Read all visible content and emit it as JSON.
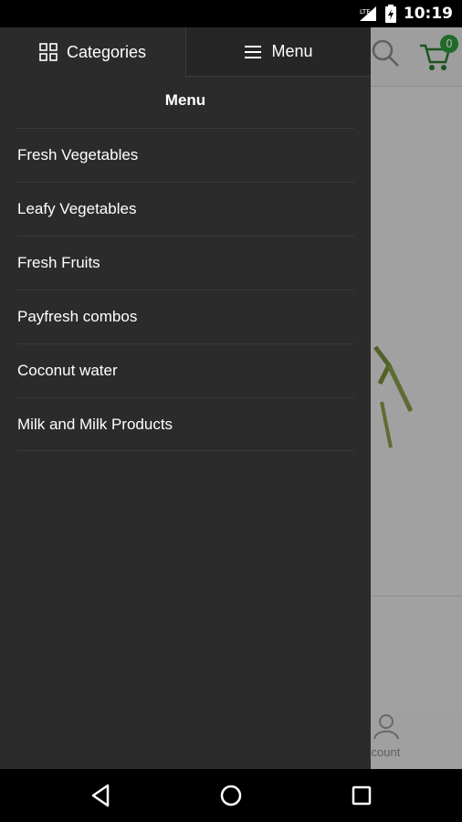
{
  "status_bar": {
    "time": "10:19",
    "icons": [
      "signal-icon",
      "battery-icon"
    ]
  },
  "app": {
    "cart_count": "0",
    "account_label": "ccount",
    "accent_color": "#2e9e3a"
  },
  "drawer": {
    "tabs": [
      {
        "label": "Categories",
        "icon": "grid-icon"
      },
      {
        "label": "Menu",
        "icon": "hamburger-icon"
      }
    ],
    "title": "Menu",
    "items": [
      {
        "label": "Fresh Vegetables"
      },
      {
        "label": "Leafy Vegetables"
      },
      {
        "label": "Fresh Fruits"
      },
      {
        "label": "Payfresh combos"
      },
      {
        "label": "Coconut water"
      },
      {
        "label": "Milk and Milk Products"
      }
    ]
  },
  "nav_bar": {
    "buttons": [
      "back-icon",
      "home-icon",
      "recents-icon"
    ]
  }
}
